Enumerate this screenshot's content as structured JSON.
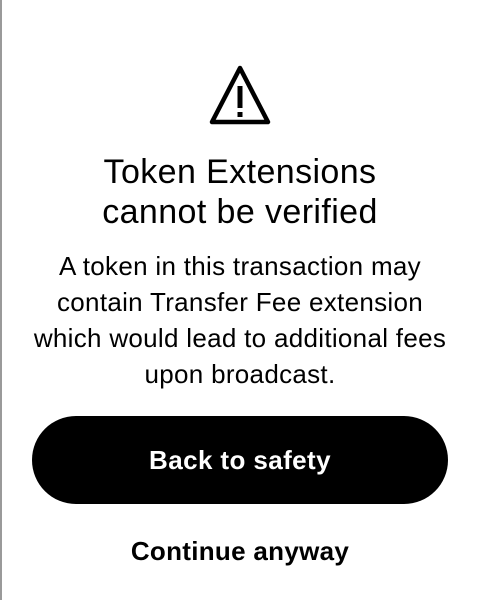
{
  "dialog": {
    "icon": "warning-triangle-icon",
    "title_line_1": "Token Extensions",
    "title_line_2": "cannot be verified",
    "description": "A token in this transaction may contain Transfer Fee extension which would lead to additional fees upon broadcast.",
    "primary_action_label": "Back to safety",
    "secondary_action_label": "Continue anyway"
  },
  "colors": {
    "background": "#ffffff",
    "text": "#000000",
    "primary_button_bg": "#000000",
    "primary_button_text": "#ffffff"
  }
}
